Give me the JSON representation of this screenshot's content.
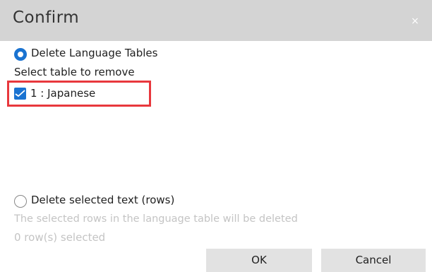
{
  "dialog": {
    "title": "Confirm",
    "close_glyph": "×"
  },
  "options": {
    "delete_tables": {
      "label": "Delete Language Tables",
      "checked": true
    },
    "select_table_label": "Select table to remove",
    "tables": [
      {
        "label": "1 : Japanese",
        "checked": true
      }
    ],
    "delete_rows": {
      "label": "Delete selected text (rows)",
      "checked": false,
      "description": "The selected rows in the language table will be deleted",
      "selected_count": "0  row(s) selected"
    }
  },
  "buttons": {
    "ok_label": "OK",
    "cancel_label": "Cancel"
  },
  "colors": {
    "accent": "#1a73d1",
    "highlight": "#e8383d",
    "titlebar": "#d4d4d4",
    "button": "#e2e2e2"
  },
  "icons": {
    "close": "close-icon",
    "check": "checkmark-icon"
  }
}
